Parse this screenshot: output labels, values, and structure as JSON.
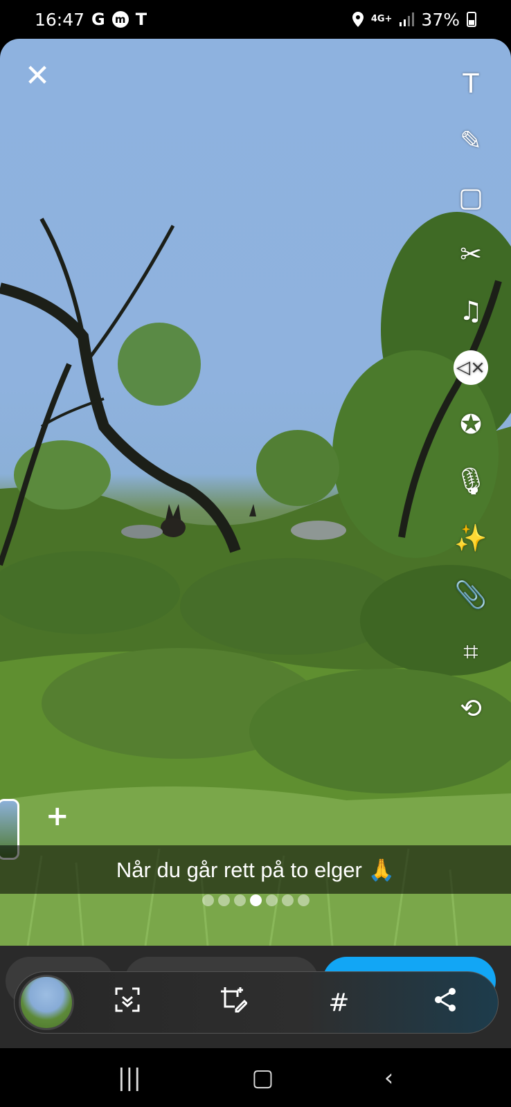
{
  "status_bar": {
    "time": "16:47",
    "apps": [
      "G",
      "m",
      "T"
    ],
    "network": "4G+",
    "battery": "37%"
  },
  "editor": {
    "close_icon": "✕",
    "tools": [
      {
        "name": "text-tool",
        "icon": "T"
      },
      {
        "name": "pencil-tool",
        "icon": "✎"
      },
      {
        "name": "sticker-tool",
        "icon": "▢"
      },
      {
        "name": "scissors-tool",
        "icon": "✂"
      },
      {
        "name": "music-tool",
        "icon": "♫"
      },
      {
        "name": "mute-tool",
        "icon": "◁×"
      },
      {
        "name": "lens-tool",
        "icon": "✪"
      },
      {
        "name": "voice-tool",
        "icon": "🎙"
      },
      {
        "name": "magic-tool",
        "icon": "✨"
      },
      {
        "name": "attach-tool",
        "icon": "📎"
      },
      {
        "name": "crop-tool",
        "icon": "⌗"
      },
      {
        "name": "loop-tool",
        "icon": "⟲"
      }
    ],
    "add_icon": "+",
    "caption": "Når du går rett på to elger 🙏",
    "page_dots": 7,
    "active_dot": 3
  },
  "action_bar": {
    "scan_icon": "⌄",
    "edit_icon": "✎",
    "hashtag_icon": "#",
    "share_icon": "⋖"
  },
  "nav_bar": {
    "recents_icon": "|||",
    "home_icon": "▢",
    "back_icon": "‹"
  },
  "colors": {
    "sky": "#8eb2df",
    "foliage": "#4f7a2e",
    "send_blue": "#12a6f5"
  }
}
